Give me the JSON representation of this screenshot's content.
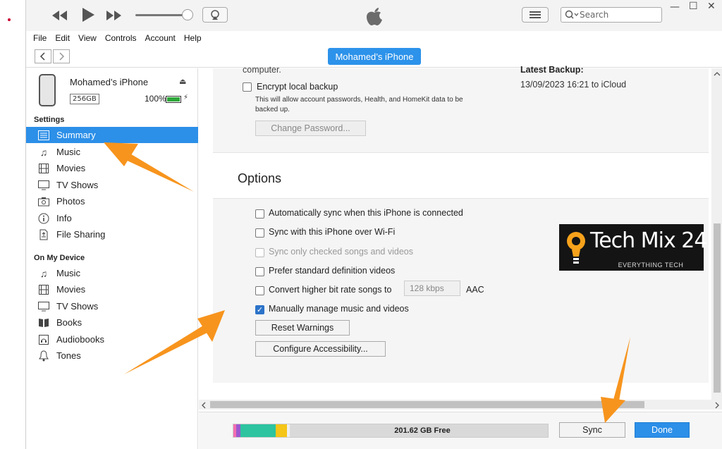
{
  "window": {
    "search_placeholder": "Search"
  },
  "menu": [
    "File",
    "Edit",
    "View",
    "Controls",
    "Account",
    "Help"
  ],
  "nav": {
    "device_button": "Mohamed’s iPhone"
  },
  "device": {
    "name": "Mohamed’s iPhone",
    "capacity": "256GB",
    "battery": "100%",
    "battery_level": 1.0
  },
  "sidebar": {
    "settings_header": "Settings",
    "settings_items": [
      {
        "label": "Summary",
        "icon": "summary-icon"
      },
      {
        "label": "Music",
        "icon": "music-note-icon"
      },
      {
        "label": "Movies",
        "icon": "film-icon"
      },
      {
        "label": "TV Shows",
        "icon": "tv-icon"
      },
      {
        "label": "Photos",
        "icon": "camera-icon"
      },
      {
        "label": "Info",
        "icon": "info-icon"
      },
      {
        "label": "File Sharing",
        "icon": "file-sharing-icon"
      }
    ],
    "device_header": "On My Device",
    "device_items": [
      {
        "label": "Music",
        "icon": "music-note-icon"
      },
      {
        "label": "Movies",
        "icon": "film-icon"
      },
      {
        "label": "TV Shows",
        "icon": "tv-icon"
      },
      {
        "label": "Books",
        "icon": "book-icon"
      },
      {
        "label": "Audiobooks",
        "icon": "audiobook-icon"
      },
      {
        "label": "Tones",
        "icon": "bell-icon"
      }
    ]
  },
  "backup": {
    "cut_text": "computer.",
    "encrypt_label": "Encrypt local backup",
    "encrypt_desc_1": "This will allow account passwords, Health, and HomeKit data to be",
    "encrypt_desc_2": "backed up.",
    "change_password": "Change Password...",
    "latest_title": "Latest Backup:",
    "latest_value": "13/09/2023 16:21 to iCloud"
  },
  "options": {
    "title": "Options",
    "auto_sync": "Automatically sync when this iPhone is connected",
    "wifi_sync": "Sync with this iPhone over Wi-Fi",
    "checked_only": "Sync only checked songs and videos",
    "prefer_sd": "Prefer standard definition videos",
    "convert": "Convert higher bit rate songs to",
    "bitrate": "128 kbps",
    "aac": "AAC",
    "manual": "Manually manage music and videos",
    "reset_warnings": "Reset Warnings",
    "configure_accessibility": "Configure Accessibility..."
  },
  "footer": {
    "free": "201.62 GB Free",
    "sync": "Sync",
    "done": "Done"
  },
  "logo": {
    "text": "Tech Mix 24",
    "tagline": "EVERYTHING TECH"
  },
  "colors": {
    "accent": "#2c8fe8",
    "arrow": "#f7941d"
  }
}
